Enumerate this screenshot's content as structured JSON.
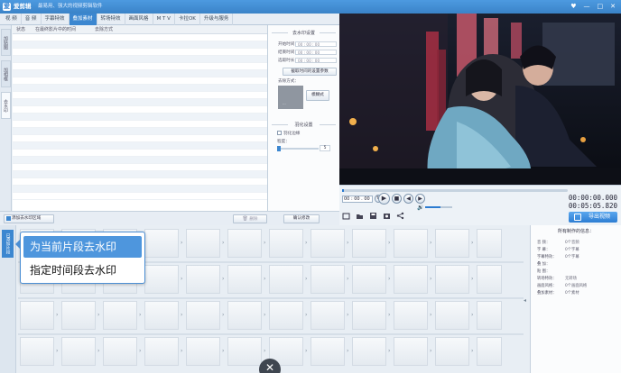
{
  "app": {
    "name": "爱剪辑",
    "slogan": "最易用、强大的视频剪辑软件",
    "window_buttons": [
      "♥",
      "—",
      "□",
      "✕"
    ]
  },
  "tabs": [
    {
      "label": "视 频"
    },
    {
      "label": "音 频"
    },
    {
      "label": "字幕特效"
    },
    {
      "label": "叠加素材"
    },
    {
      "label": "转场特效"
    },
    {
      "label": "画面风格"
    },
    {
      "label": "M T V"
    },
    {
      "label": "卡拉OK"
    },
    {
      "label": "升级与服务"
    }
  ],
  "active_tab": 3,
  "side_tabs": [
    {
      "label": "加贴图"
    },
    {
      "label": "加相框"
    },
    {
      "label": "去水印"
    }
  ],
  "table": {
    "columns": [
      "状态",
      "在最终影片中的时间",
      "去除方式"
    ]
  },
  "settings": {
    "time_section": "去水印设置",
    "start_label": "开始时间：",
    "end_label": "结束时间：",
    "duration_label": "选取时长：",
    "time_placeholder": "00 : 00 : 00",
    "pick_button": "截取时间的设置参数",
    "method_label": "去除方式：",
    "thumb_caption": "...",
    "blur_button": "模糊式",
    "mix_section": "羽化设置",
    "checkbox_label": "羽化边缘",
    "degree_label": "程度：",
    "degree_value": "5",
    "confirm_button": "确认修改"
  },
  "bottombar": {
    "add_button": "添加去水印区域",
    "delete_button": "删除"
  },
  "player": {
    "time_input": "00 : 00 . 00",
    "current_time": "00:00:00.000",
    "total_time": "00:05:05.820",
    "export_button": "导出视频",
    "icons": [
      "crop-icon",
      "folder-icon",
      "save-icon",
      "screenshot-icon",
      "share-icon"
    ]
  },
  "timeline": {
    "label": "已添加片段"
  },
  "tooltip": {
    "items": [
      "为当前片段去水印",
      "指定时间段去水印"
    ]
  },
  "info": {
    "title": "所有制作的信息：",
    "rows": [
      {
        "label": "音 频：",
        "value": "0个音频"
      },
      {
        "label": "字 幕：",
        "value": "0个字幕"
      },
      {
        "label": "字幕特效：",
        "value": "0个字幕"
      },
      {
        "label": "叠 加：",
        "value": ""
      },
      {
        "label": "贴 图：",
        "value": ""
      },
      {
        "label": "转场特效：",
        "value": "无转场"
      },
      {
        "label": "画面风格：",
        "value": "0个画面风格"
      },
      {
        "label": "叠加素材：",
        "value": "0个素材"
      }
    ]
  },
  "fab_icon": "close-icon"
}
